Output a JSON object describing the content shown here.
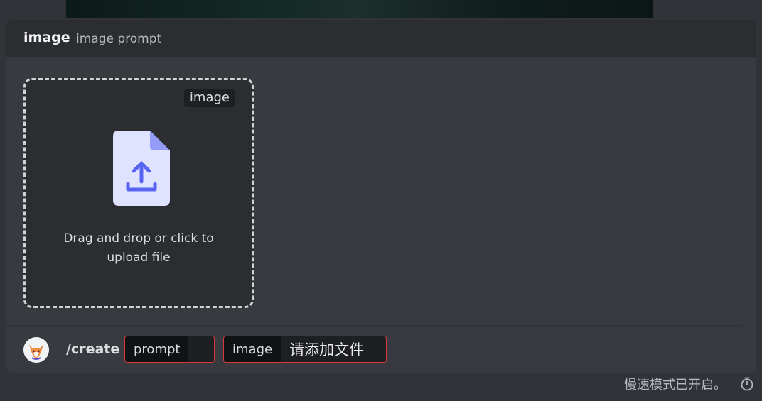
{
  "panel": {
    "title": "image",
    "subtitle": "image prompt"
  },
  "dropzone": {
    "tag": "image",
    "icon": "upload-file-icon",
    "text_line1": "Drag and drop or click to",
    "text_line2": "upload file"
  },
  "command_bar": {
    "avatar": "fox-avatar",
    "command": "/create",
    "options": [
      {
        "name": "prompt",
        "value": ""
      },
      {
        "name": "image",
        "value": "请添加文件"
      }
    ]
  },
  "footer": {
    "status": "慢速模式已开启。",
    "icon": "stopwatch-icon"
  },
  "colors": {
    "background": "#313338",
    "panel": "#383a40",
    "header": "#2b2d31",
    "accent": "#5865f2",
    "error_border": "#da373c"
  }
}
